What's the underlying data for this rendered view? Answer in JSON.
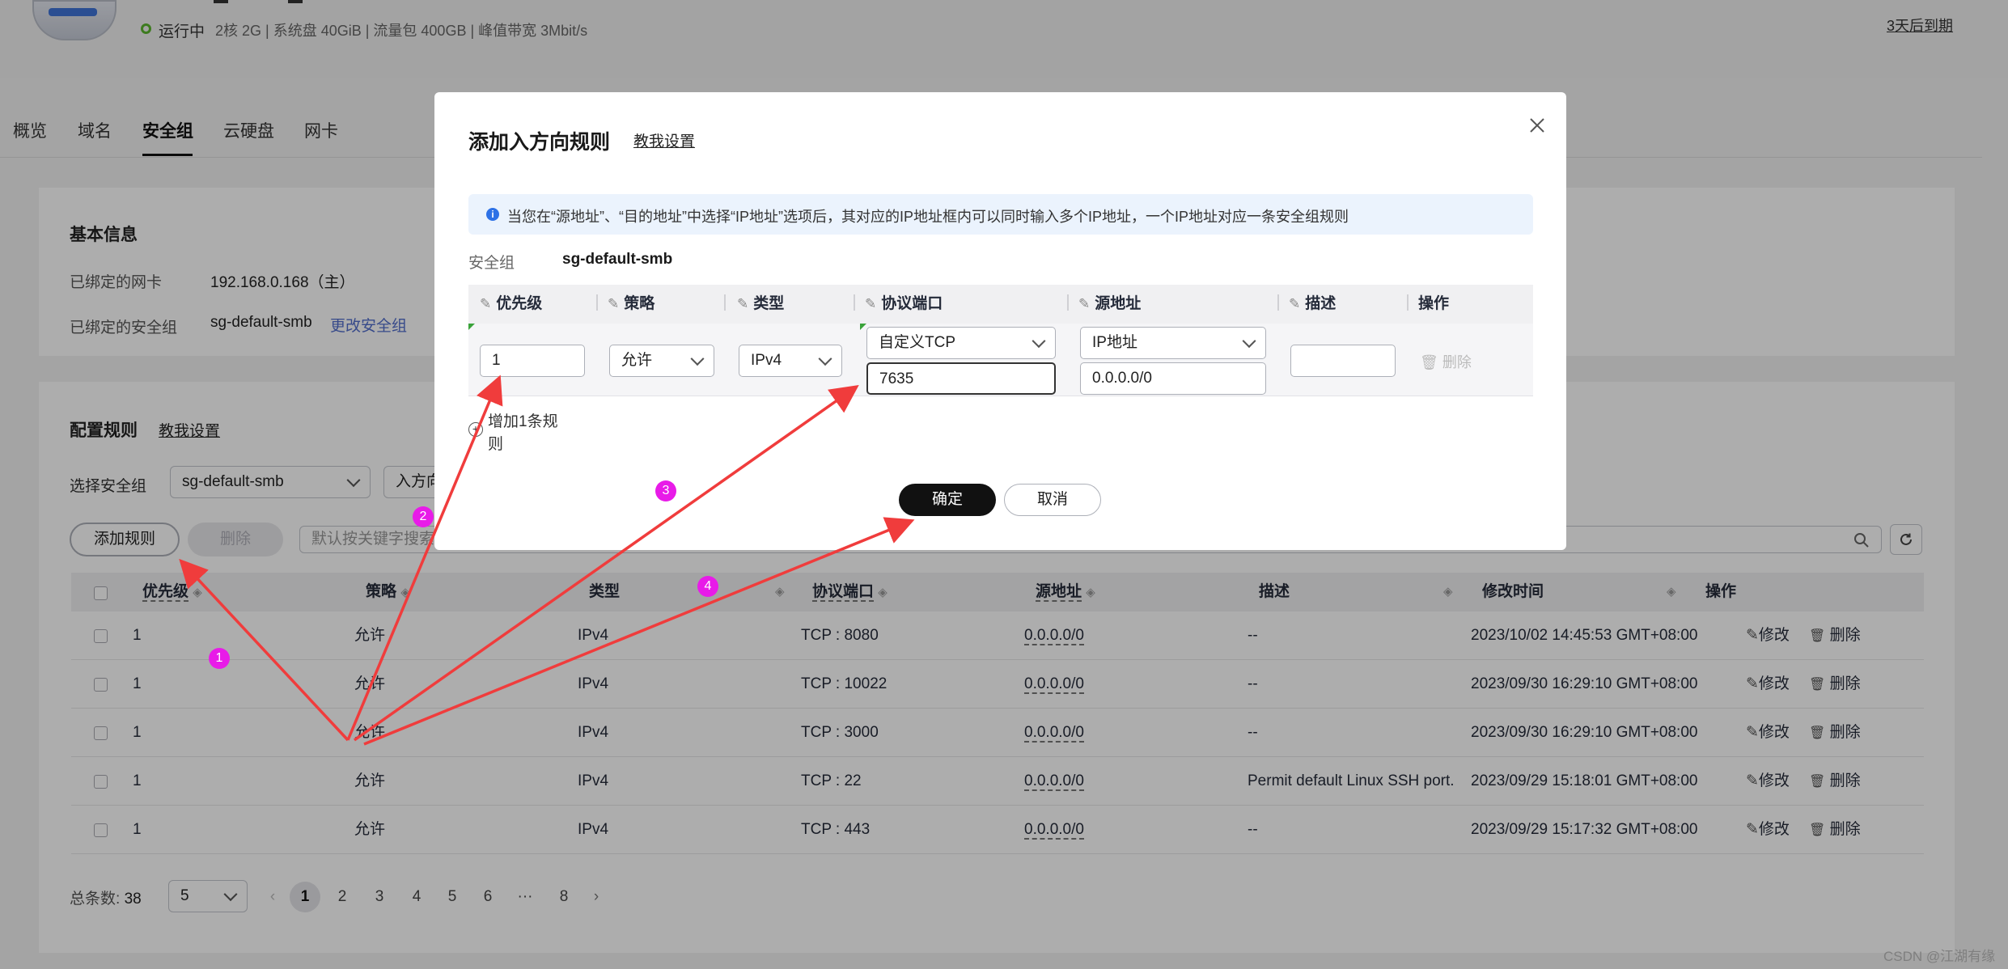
{
  "server": {
    "status": "运行中",
    "specs": "2核  2G | 系统盘 40GiB | 流量包 400GB | 峰值带宽 3Mbit/s",
    "expiry": "3天后到期"
  },
  "tabs": [
    "概览",
    "域名",
    "安全组",
    "云硬盘",
    "网卡"
  ],
  "active_tab": "安全组",
  "basic_info": {
    "title": "基本信息",
    "nic_label": "已绑定的网卡",
    "nic_value": "192.168.0.168（主）",
    "sg_label": "已绑定的安全组",
    "sg_value": "sg-default-smb",
    "change_link": "更改安全组"
  },
  "config_rules": {
    "title": "配置规则",
    "help_link": "教我设置",
    "select_label": "选择安全组",
    "selected_group": "sg-default-smb",
    "direction": "入方向",
    "add_button": "添加规则",
    "delete_button": "删除",
    "search_placeholder": "默认按关键字搜索"
  },
  "table": {
    "headers": [
      "优先级",
      "策略",
      "类型",
      "协议端口",
      "源地址",
      "描述",
      "修改时间",
      "操作"
    ],
    "rows": [
      {
        "priority": "1",
        "policy": "允许",
        "type": "IPv4",
        "port": "TCP : 8080",
        "source": "0.0.0.0/0",
        "desc": "--",
        "time": "2023/10/02 14:45:53 GMT+08:00"
      },
      {
        "priority": "1",
        "policy": "允许",
        "type": "IPv4",
        "port": "TCP : 10022",
        "source": "0.0.0.0/0",
        "desc": "--",
        "time": "2023/09/30 16:29:10 GMT+08:00"
      },
      {
        "priority": "1",
        "policy": "允许",
        "type": "IPv4",
        "port": "TCP : 3000",
        "source": "0.0.0.0/0",
        "desc": "--",
        "time": "2023/09/30 16:29:10 GMT+08:00"
      },
      {
        "priority": "1",
        "policy": "允许",
        "type": "IPv4",
        "port": "TCP : 22",
        "source": "0.0.0.0/0",
        "desc": "Permit default Linux SSH port.",
        "time": "2023/09/29 15:18:01 GMT+08:00"
      },
      {
        "priority": "1",
        "policy": "允许",
        "type": "IPv4",
        "port": "TCP : 443",
        "source": "0.0.0.0/0",
        "desc": "--",
        "time": "2023/09/29 15:17:32 GMT+08:00"
      }
    ],
    "edit_label": "修改",
    "delete_label": "删除"
  },
  "pagination": {
    "total_label": "总条数:",
    "total": "38",
    "page_size": "5",
    "pages": [
      "1",
      "2",
      "3",
      "4",
      "5",
      "6",
      "···",
      "8"
    ],
    "current": "1"
  },
  "modal": {
    "title": "添加入方向规则",
    "help_link": "教我设置",
    "info": "当您在“源地址”、“目的地址”中选择“IP地址”选项后，其对应的IP地址框内可以同时输入多个IP地址，一个IP地址对应一条安全组规则",
    "sg_label": "安全组",
    "sg_value": "sg-default-smb",
    "columns": [
      "优先级",
      "策略",
      "类型",
      "协议端口",
      "源地址",
      "描述",
      "操作"
    ],
    "priority_value": "1",
    "policy_value": "允许",
    "type_value": "IPv4",
    "protocol_value": "自定义TCP",
    "port_value": "7635",
    "source_type": "IP地址",
    "source_value": "0.0.0.0/0",
    "desc_value": "",
    "row_delete": "删除",
    "add_rule": "增加1条规则",
    "confirm": "确定",
    "cancel": "取消"
  },
  "annotations": [
    "1",
    "2",
    "3",
    "4"
  ],
  "watermark": "CSDN @江湖有缘",
  "colors": {
    "arrow": "#f03c3c",
    "badge": "#e81be8",
    "link": "#526ecc",
    "primary_button": "#111111"
  }
}
